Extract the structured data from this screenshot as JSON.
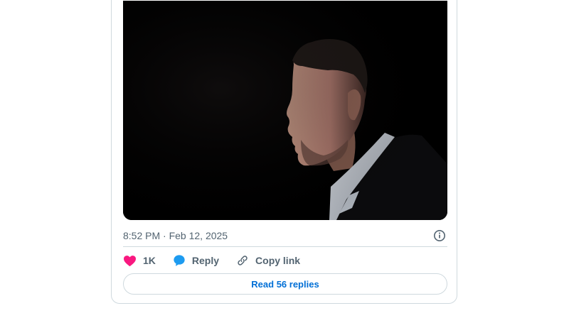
{
  "tweet": {
    "media": {
      "icon": "portrait-photo",
      "background": "#000000"
    },
    "timestamp": "8:52 PM · Feb 12, 2025",
    "info_icon": "info-icon",
    "actions": {
      "like": {
        "icon": "heart-icon",
        "label": "1K",
        "color": "#f91880"
      },
      "reply": {
        "icon": "speech-bubble-icon",
        "label": "Reply",
        "color": "#1d9bf0"
      },
      "copy_link": {
        "icon": "link-icon",
        "label": "Copy link"
      }
    },
    "read_replies_label": "Read 56 replies",
    "colors": {
      "border": "#cfd9de",
      "muted_text": "#536471",
      "link_blue": "#006fd6"
    }
  }
}
